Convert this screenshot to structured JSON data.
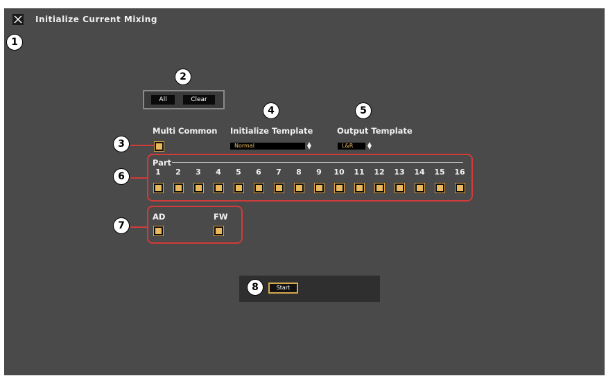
{
  "window": {
    "title": "Initialize Current Mixing"
  },
  "buttons": {
    "all": "All",
    "clear": "Clear",
    "start": "Start"
  },
  "sections": {
    "multi_common": "Multi Common",
    "initialize_template": "Initialize Template",
    "output_template": "Output Template",
    "part": "Part"
  },
  "selects": {
    "initialize_template": "Normal",
    "output_template": "L&R"
  },
  "parts": [
    "1",
    "2",
    "3",
    "4",
    "5",
    "6",
    "7",
    "8",
    "9",
    "10",
    "11",
    "12",
    "13",
    "14",
    "15",
    "16"
  ],
  "inputs": {
    "ad": "AD",
    "fw": "FW"
  },
  "callouts": [
    "1",
    "2",
    "3",
    "4",
    "5",
    "6",
    "7",
    "8"
  ],
  "colors": {
    "background": "#4a4a4a",
    "checkbox": "#e9b85a",
    "highlight": "#d33a3a"
  }
}
